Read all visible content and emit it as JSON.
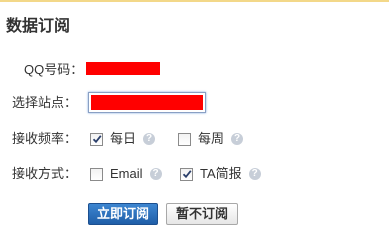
{
  "title": "数据订阅",
  "form": {
    "qq_label": "QQ号码：",
    "site_label": "选择站点：",
    "frequency_label": "接收频率：",
    "method_label": "接收方式：",
    "frequency_options": [
      {
        "label": "每日",
        "checked": true
      },
      {
        "label": "每周",
        "checked": false
      }
    ],
    "method_options": [
      {
        "label": "Email",
        "checked": false
      },
      {
        "label": "TA简报",
        "checked": true
      }
    ],
    "help_icon_glyph": "?"
  },
  "buttons": {
    "subscribe": "立即订阅",
    "not_now": "暂不订阅"
  },
  "colors": {
    "primary_button": "#2a6fbd",
    "redaction": "#ff0000",
    "top_border": "#f3d889"
  }
}
